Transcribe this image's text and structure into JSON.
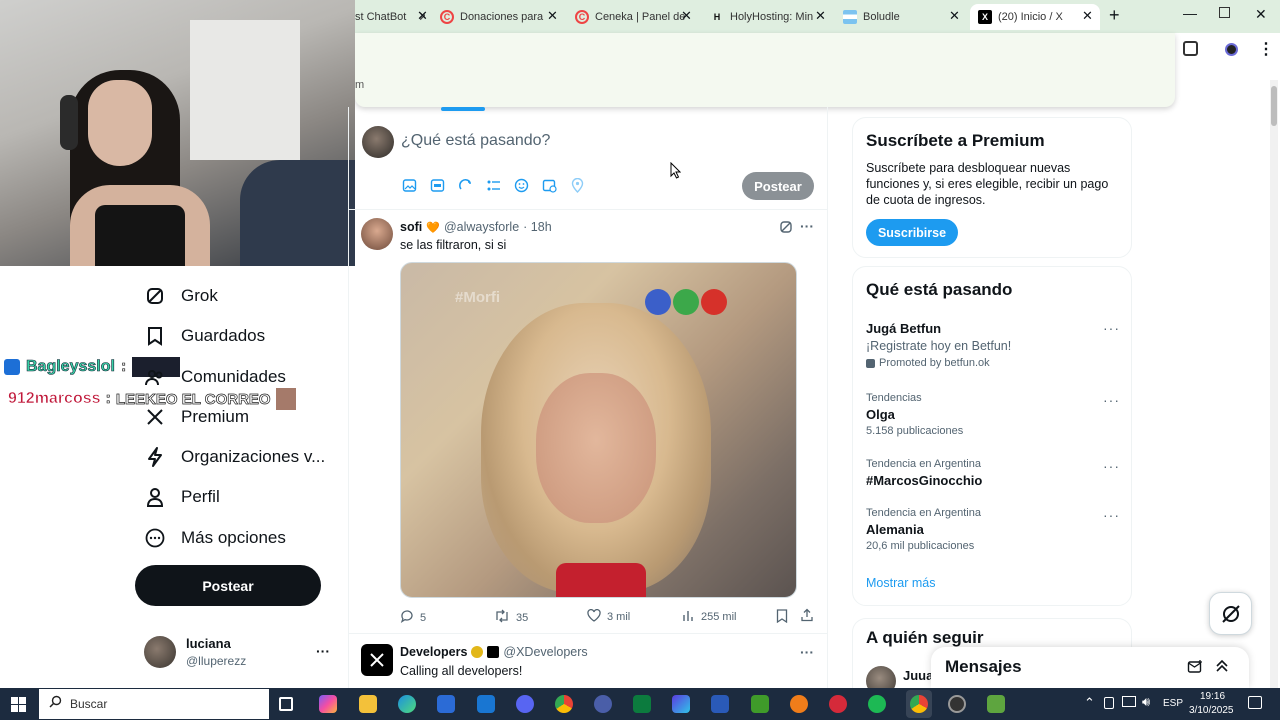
{
  "browser": {
    "tabs": [
      {
        "label": "st ChatBot"
      },
      {
        "label": "Donaciones para"
      },
      {
        "label": "Ceneka | Panel de"
      },
      {
        "label": "HolyHosting: Min"
      },
      {
        "label": "Boludle"
      },
      {
        "label": "(20) Inicio / X"
      }
    ],
    "omnibox_fragment": "m"
  },
  "stream_chat": [
    {
      "user": "Bagleysslol",
      "sep": ":"
    },
    {
      "user": "912marcoss",
      "sep": ":",
      "message": "LEEKEO EL CORREO"
    }
  ],
  "nav": {
    "items": [
      {
        "label": "Grok",
        "icon": "grok-icon"
      },
      {
        "label": "Guardados",
        "icon": "bookmark-icon"
      },
      {
        "label": "Comunidades",
        "icon": "communities-icon"
      },
      {
        "label": "Premium",
        "icon": "x-logo-icon"
      },
      {
        "label": "Organizaciones v...",
        "icon": "lightning-icon"
      },
      {
        "label": "Perfil",
        "icon": "person-icon"
      },
      {
        "label": "Más opciones",
        "icon": "more-circle-icon"
      }
    ],
    "post_button": "Postear",
    "account": {
      "name": "luciana",
      "handle": "@lluperezz",
      "more": "···"
    }
  },
  "composer": {
    "placeholder": "¿Qué está pasando?",
    "post_button": "Postear"
  },
  "tweets": [
    {
      "name": "sofi",
      "heart": "🧡",
      "handle": "@alwaysforle",
      "time": "· 18h",
      "text": "se las filtraron, si si",
      "media_watermark": "#Morfi",
      "replies": "5",
      "retweets": "35",
      "likes": "3 mil",
      "views": "255 mil"
    },
    {
      "name": "Developers",
      "handle": "@XDevelopers",
      "text": "Calling all developers!"
    }
  ],
  "premium_card": {
    "title": "Suscríbete a Premium",
    "body": "Suscríbete para desbloquear nuevas funciones y, si eres elegible, recibir un pago de cuota de ingresos.",
    "button": "Suscribirse"
  },
  "trends_card": {
    "title": "Qué está pasando",
    "items": [
      {
        "name": "Jugá Betfun",
        "sub": "¡Registrate hoy en Betfun!",
        "promo": "Promoted by betfun.ok"
      },
      {
        "meta": "Tendencias",
        "name": "Olga",
        "count": "5.158 publicaciones"
      },
      {
        "meta": "Tendencia en Argentina",
        "name": "#MarcosGinocchio"
      },
      {
        "meta": "Tendencia en Argentina",
        "name": "Alemania",
        "count": "20,6 mil publicaciones"
      }
    ],
    "show_more": "Mostrar más"
  },
  "follow_card": {
    "title": "A quién seguir",
    "partial_name": "Juua"
  },
  "messages": {
    "title": "Mensajes"
  },
  "taskbar": {
    "search": "Buscar",
    "lang": "ESP",
    "time": "19:16",
    "date": "3/10/2025"
  },
  "colors": {
    "x_blue": "#1d9bf0",
    "chrome_tab_bg": "#dfeee0",
    "taskbar": "#1c2b3f"
  }
}
